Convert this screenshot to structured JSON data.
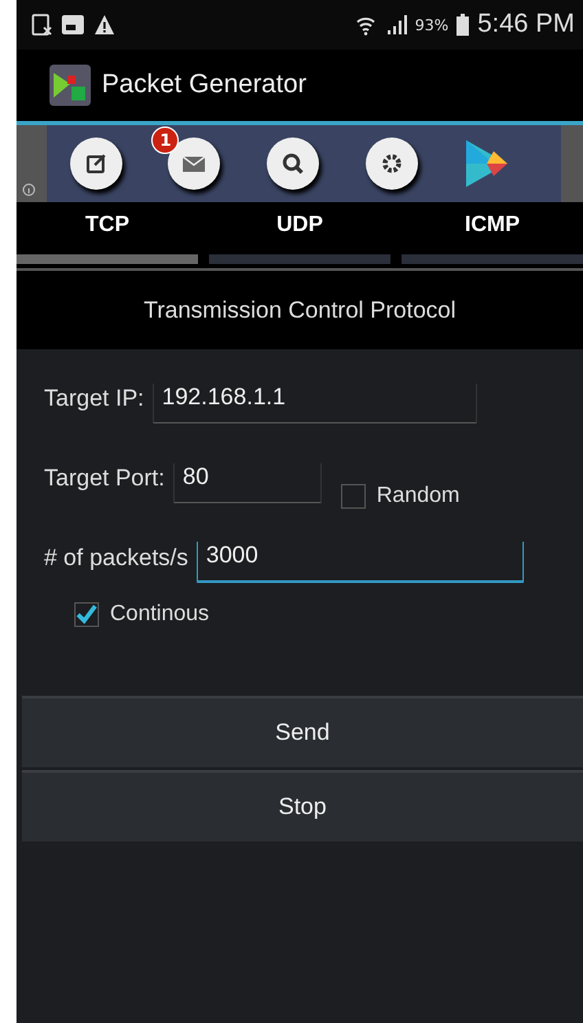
{
  "status_bar": {
    "battery": "93%",
    "time": "5:46 PM"
  },
  "app_bar": {
    "title": "Packet Generator"
  },
  "toolbar": {
    "buttons": [
      {
        "kind": "edit"
      },
      {
        "kind": "mail",
        "badge": "1"
      },
      {
        "kind": "search"
      },
      {
        "kind": "settings"
      },
      {
        "kind": "play"
      }
    ]
  },
  "tabs": [
    {
      "label": "TCP",
      "selected": true
    },
    {
      "label": "UDP",
      "selected": false
    },
    {
      "label": "ICMP",
      "selected": false
    }
  ],
  "subtitle": "Transmission Control Protocol",
  "fields": [
    {
      "label": "Target IP:",
      "value": "192.168.1.1",
      "focused": false
    },
    {
      "label": "Target Port:",
      "value": "80",
      "focused": false,
      "checkbox": {
        "label": "Random",
        "checked": false
      }
    },
    {
      "label": "# of packets/s",
      "value": "3000",
      "focused": true
    }
  ],
  "continuous": {
    "label": "Continous",
    "checked": true
  },
  "buttons": [
    "Send",
    "Stop"
  ]
}
